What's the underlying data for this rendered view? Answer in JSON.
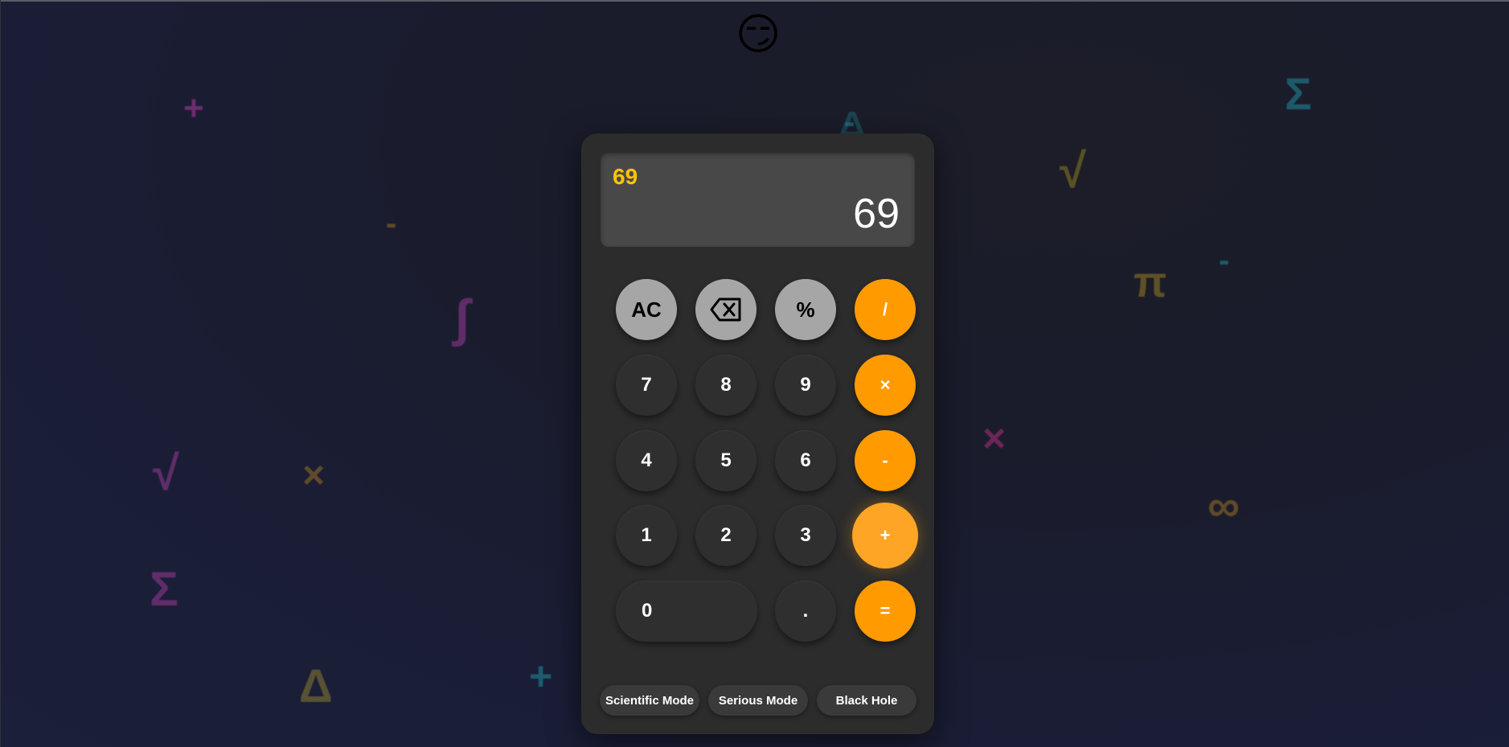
{
  "header": {
    "emoji": "😏"
  },
  "display": {
    "expression": "69",
    "result": "69"
  },
  "keys": {
    "ac": "AC",
    "percent": "%",
    "divide": "/",
    "seven": "7",
    "eight": "8",
    "nine": "9",
    "multiply": "×",
    "four": "4",
    "five": "5",
    "six": "6",
    "minus": "-",
    "one": "1",
    "two": "2",
    "three": "3",
    "plus": "+",
    "zero": "0",
    "decimal": ".",
    "equals": "="
  },
  "modes": {
    "scientific": "Scientific Mode",
    "serious": "Serious Mode",
    "black_hole": "Black Hole"
  },
  "background_symbols": [
    "+",
    "Σ",
    "√",
    "π",
    "-",
    "-",
    "∫",
    "-",
    "×",
    "√",
    "×",
    "∞",
    "Σ",
    "Δ",
    "+",
    "Δ"
  ],
  "colors": {
    "accent": "#ff9a00",
    "expression": "#ffc400",
    "function_key": "#a6a6a6",
    "number_key": "#2f2f2f",
    "body": "#2c2c2c"
  }
}
